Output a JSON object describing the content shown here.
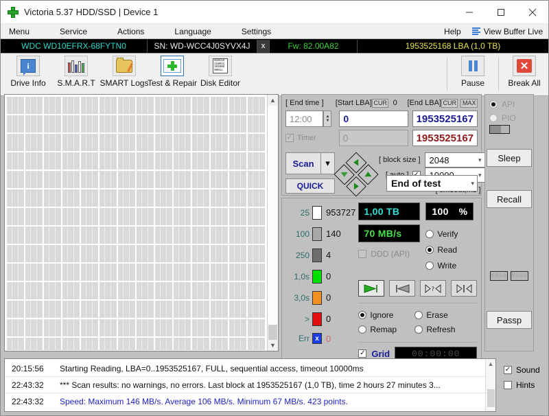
{
  "window": {
    "title": "Victoria 5.37 HDD/SSD | Device 1",
    "logo_icon": "green-cross-icon",
    "minimize_icon": "minimize-icon",
    "maximize_icon": "maximize-icon",
    "close_icon": "close-icon"
  },
  "menubar": {
    "items": [
      "Menu",
      "Service",
      "Actions",
      "Language",
      "Settings"
    ],
    "help": "Help",
    "view_buffer": "View Buffer Live",
    "view_buffer_icon": "lines-icon"
  },
  "drivebar": {
    "model": "WDC WD10EFRX-68FYTN0",
    "serial": "SN: WD-WCC4J0SYVX4J",
    "close_label": "x",
    "firmware": "Fw: 82.00A82",
    "capacity": "1953525168 LBA (1,0 TB)",
    "colors": {
      "model": "#2fd8c8",
      "serial": "#e8e8e8",
      "firmware": "#39d23b",
      "capacity": "#e8e24a",
      "background": "#000000"
    }
  },
  "toolbar": {
    "buttons": [
      {
        "label": "Drive Info",
        "icon": "info-icon",
        "active": false
      },
      {
        "label": "S.M.A.R.T",
        "icon": "test-tubes-icon",
        "active": false
      },
      {
        "label": "SMART Logs",
        "icon": "folder-pencil-icon",
        "active": false
      },
      {
        "label": "Test & Repair",
        "icon": "first-aid-icon",
        "active": true
      },
      {
        "label": "Disk Editor",
        "icon": "hex-page-icon",
        "active": false
      }
    ],
    "right_buttons": [
      {
        "label": "Pause",
        "icon": "pause-icon"
      },
      {
        "label": "Break All",
        "icon": "red-x-icon"
      }
    ],
    "hex_lines": [
      "010110",
      "110011",
      "101000",
      "0001ı"
    ]
  },
  "test_panel": {
    "end_time_label": "[ End time ]",
    "end_time_value": "12:00",
    "timer_label": "Timer",
    "timer_checked": true,
    "timer_value": "0",
    "start_lba_label": "[Start LBA]",
    "start_lba_cur": "CUR",
    "start_lba_zero": "0",
    "start_lba_value": "0",
    "end_lba_label": "[End LBA]",
    "end_lba_cur": "CUR",
    "end_lba_max": "MAX",
    "end_lba_value": "1953525167",
    "end_lba_value2": "1953525167",
    "scan_button": "Scan",
    "scan_dropdown_icon": "chevron-down-icon",
    "quick_button": "QUICK",
    "nav_icon": "diamond-navigation-icon",
    "block_size_label": "[ block size ]",
    "auto_label": "[ auto ]",
    "auto_checked": true,
    "block_size_value": "2048",
    "timeout_label": "[ timeout,ms ]",
    "timeout_value": "10000",
    "end_of_test_value": "End of test"
  },
  "histogram": {
    "rows": [
      {
        "key": "25",
        "color": "#ffffff",
        "value": "953727"
      },
      {
        "key": "100",
        "color": "#a8a8a8",
        "value": "140"
      },
      {
        "key": "250",
        "color": "#6e6e6e",
        "value": "4"
      },
      {
        "key": "1,0s",
        "color": "#00e000",
        "value": "0"
      },
      {
        "key": "3,0s",
        "color": "#f09020",
        "value": "0"
      },
      {
        "key": ">",
        "color": "#e01010",
        "value": "0"
      },
      {
        "key": "Err",
        "color": "#1a3ce0",
        "value": "0",
        "glyph": "x",
        "value_red": true
      }
    ]
  },
  "stats": {
    "capacity": "1,00 TB",
    "speed": "70 MB/s",
    "percent_value": "100",
    "percent_unit": "%",
    "ddd_label": "DDD (API)",
    "ddd_checked": false,
    "modes": [
      {
        "label": "Verify",
        "selected": false
      },
      {
        "label": "Read",
        "selected": true
      },
      {
        "label": "Write",
        "selected": false
      }
    ],
    "transport": [
      {
        "icon": "play-forward-icon",
        "selected": true
      },
      {
        "icon": "play-back-icon",
        "selected": false
      },
      {
        "icon": "random-icon",
        "selected": false
      },
      {
        "icon": "step-end-icon",
        "selected": false
      }
    ],
    "actions": [
      {
        "label": "Ignore",
        "selected": true
      },
      {
        "label": "Erase",
        "selected": false
      },
      {
        "label": "Remap",
        "selected": false
      },
      {
        "label": "Refresh",
        "selected": false
      }
    ],
    "grid_label": "Grid",
    "grid_checked": true,
    "elapsed": "00:00:00"
  },
  "sidebar": {
    "api_label": "API",
    "api_selected": true,
    "pio_label": "PIO",
    "pio_selected": false,
    "progress_icon": "mini-progress-icon",
    "sleep_button": "Sleep",
    "recall_button": "Recall",
    "mini_left": "0000",
    "mini_right": "0000",
    "passp_button": "Passp"
  },
  "log": {
    "rows": [
      {
        "time": "20:15:56",
        "message": "Starting Reading, LBA=0..1953525167, FULL, sequential access, timeout 10000ms",
        "highlight": false
      },
      {
        "time": "22:43:32",
        "message": "*** Scan results: no warnings, no errors. Last block at 1953525167 (1,0 TB), time 2 hours 27 minutes 3...",
        "highlight": false
      },
      {
        "time": "22:43:32",
        "message": "Speed: Maximum 146 MB/s. Average 106 MB/s. Minimum 67 MB/s. 423 points.",
        "highlight": true
      }
    ],
    "scroll_up_icon": "chevron-up-icon"
  },
  "bottom_options": [
    {
      "label": "Sound",
      "checked": true
    },
    {
      "label": "Hints",
      "checked": false
    }
  ]
}
